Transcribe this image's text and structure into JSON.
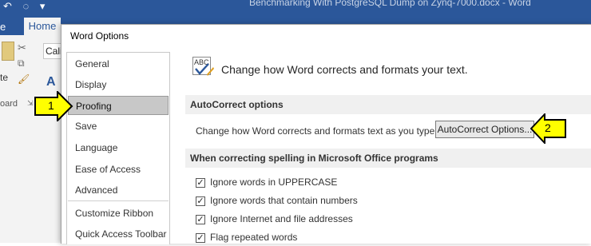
{
  "word": {
    "doc_title": "Benchmarking With PostgreSQL Dump on Zynq-7000.docx  -  Word",
    "tab_file": "e",
    "tab_home": "Home",
    "font_box": "Cali",
    "paste_label": "te",
    "clipboard_label": "oard"
  },
  "dialog": {
    "title": "Word Options"
  },
  "sidebar": {
    "items": [
      {
        "label": "General"
      },
      {
        "label": "Display"
      },
      {
        "label": "Proofing"
      },
      {
        "label": "Save"
      },
      {
        "label": "Language"
      },
      {
        "label": "Ease of Access"
      },
      {
        "label": "Advanced"
      },
      {
        "label": "Customize Ribbon"
      },
      {
        "label": "Quick Access Toolbar"
      }
    ],
    "selected": "Proofing"
  },
  "content": {
    "icon_text": "ABC",
    "header": "Change how Word corrects and formats your text.",
    "autocorrect_section": "AutoCorrect options",
    "autocorrect_label": "Change how Word corrects and formats text as you type:",
    "autocorrect_button": "AutoCorrect Options...",
    "spelling_section": "When correcting spelling in Microsoft Office programs",
    "checkboxes": [
      {
        "label": "Ignore words in UPPERCASE",
        "checked": true
      },
      {
        "label": "Ignore words that contain numbers",
        "checked": true
      },
      {
        "label": "Ignore Internet and file addresses",
        "checked": true
      },
      {
        "label": "Flag repeated words",
        "checked": true
      }
    ]
  },
  "callouts": [
    {
      "number": "1"
    },
    {
      "number": "2"
    }
  ],
  "colors": {
    "word_blue": "#2b579a",
    "callout_yellow": "#ffff00",
    "selected_item": "#c8c8c8"
  }
}
